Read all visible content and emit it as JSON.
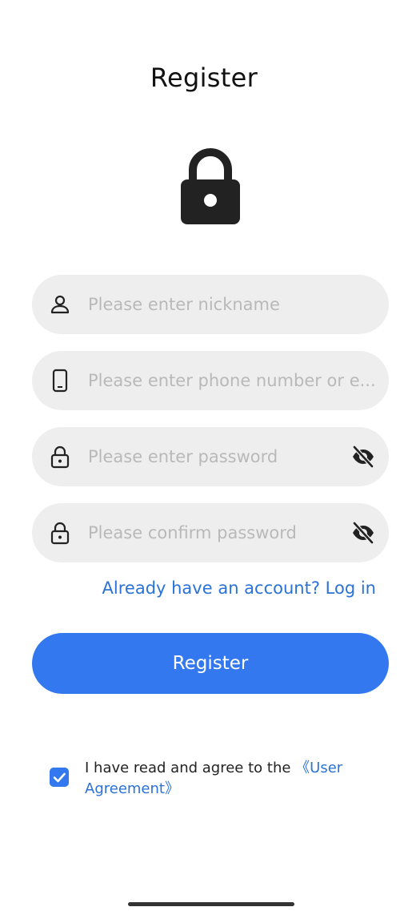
{
  "page": {
    "title": "Register"
  },
  "form": {
    "nickname": {
      "value": "",
      "placeholder": "Please enter nickname",
      "icon": "user-icon"
    },
    "account": {
      "value": "",
      "placeholder": "Please enter phone number or e...",
      "icon": "phone-icon"
    },
    "password": {
      "value": "",
      "placeholder": "Please enter password",
      "icon": "lock-icon",
      "toggle_icon": "eye-off-icon"
    },
    "confirm_password": {
      "value": "",
      "placeholder": "Please confirm password",
      "icon": "lock-icon",
      "toggle_icon": "eye-off-icon"
    }
  },
  "login_link": "Already have an account? Log in",
  "register_button": "Register",
  "agreement": {
    "checked": true,
    "text": "I have read and agree to the ",
    "link_text": "《User Agreement》"
  },
  "colors": {
    "accent": "#3378ee",
    "link": "#2a72d8",
    "field_bg": "#eeeeee",
    "placeholder": "#b9b9b9",
    "icon": "#222222"
  },
  "icons": {
    "hero": "padlock-icon"
  }
}
